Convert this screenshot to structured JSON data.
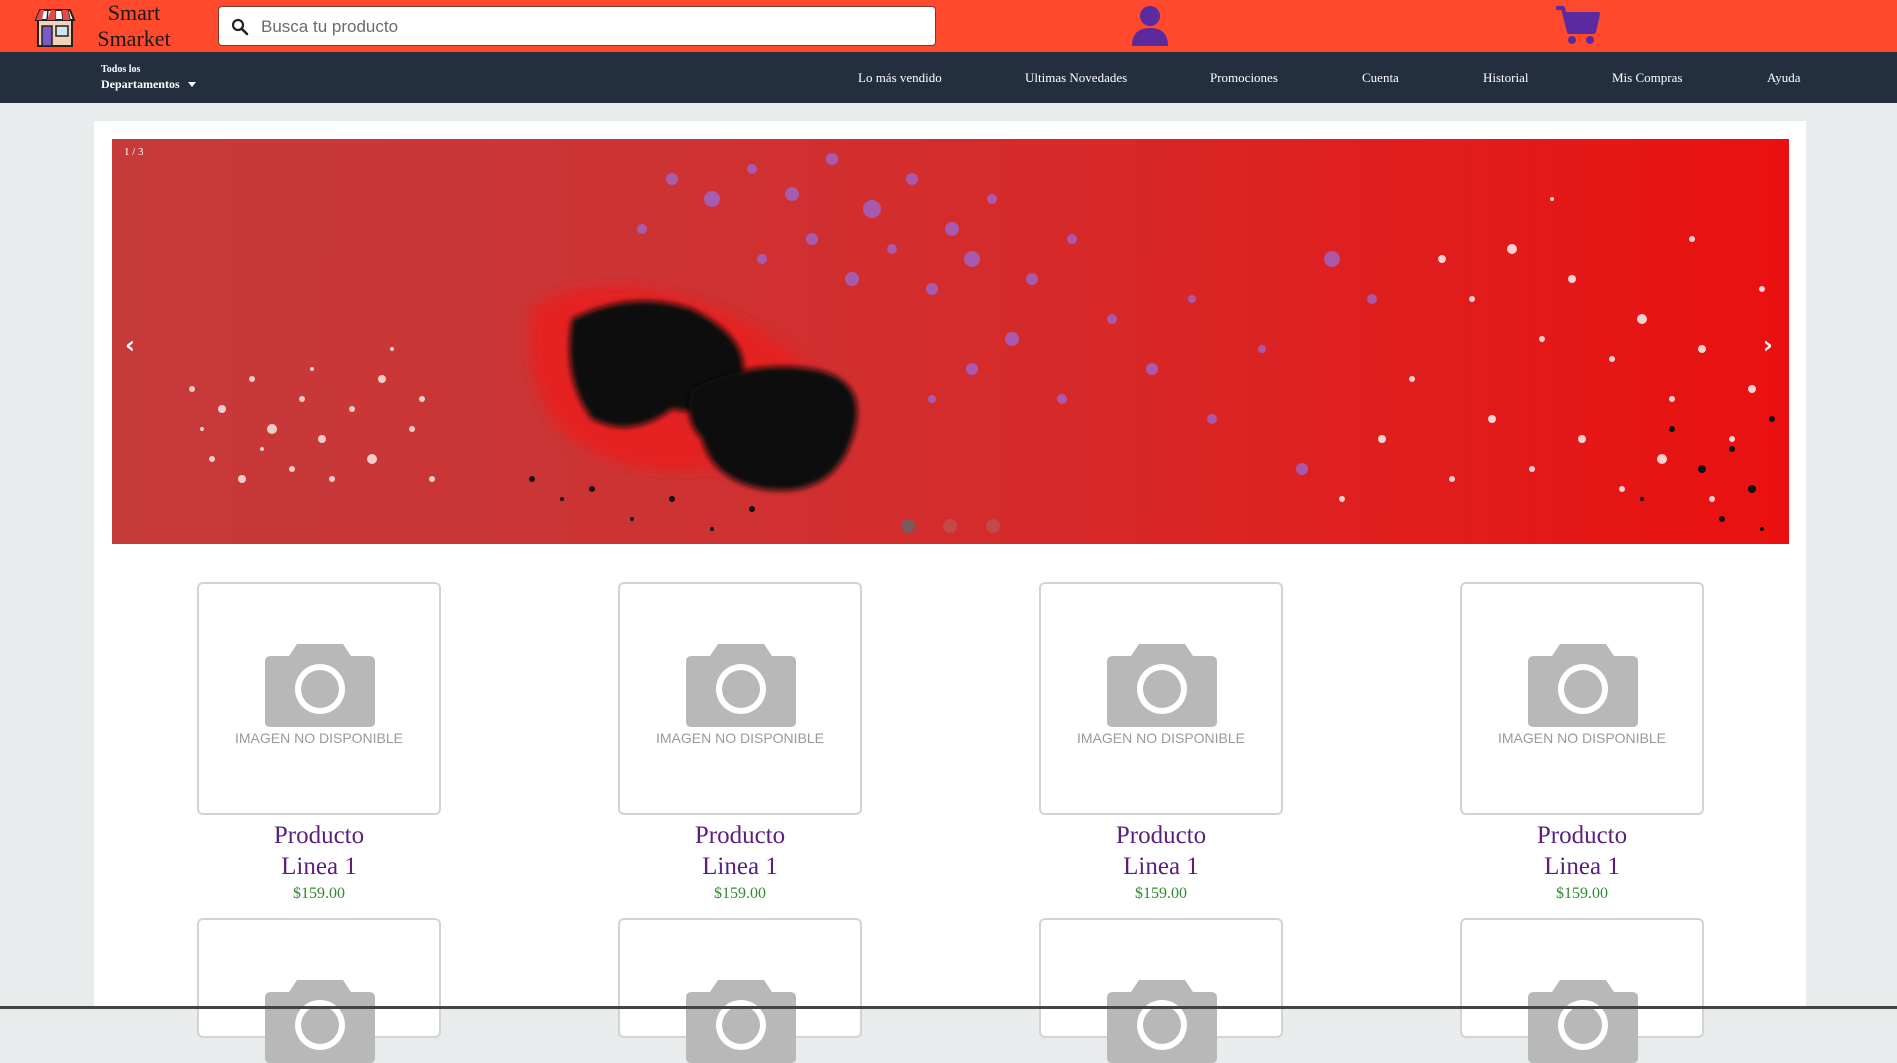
{
  "header": {
    "brand_line1": "Smart",
    "brand_line2": "Smarket",
    "logo_icon": "store-icon",
    "search": {
      "placeholder": "Busca tu producto",
      "value": "",
      "icon": "search-icon"
    },
    "user_icon": "user-icon",
    "cart_icon": "cart-icon",
    "accent_color": "#ff4a2e",
    "icon_color": "#5b2a9e"
  },
  "nav": {
    "departments_small": "Todos los",
    "departments_big": "Departamentos",
    "links": [
      "Lo más vendido",
      "Ultimas Novedades",
      "Promociones",
      "Cuenta",
      "Historial",
      "Mis Compras",
      "Ayuda"
    ],
    "background": "#232f3e"
  },
  "carousel": {
    "counter": "1 / 3",
    "prev": "‹",
    "next": "›",
    "slides_total": 3,
    "active_slide": 1
  },
  "products": [
    {
      "image_text": "IMAGEN NO DISPONIBLE",
      "name_line1": "Producto",
      "name_line2": "Linea 1",
      "price": "$159.00"
    },
    {
      "image_text": "IMAGEN NO DISPONIBLE",
      "name_line1": "Producto",
      "name_line2": "Linea 1",
      "price": "$159.00"
    },
    {
      "image_text": "IMAGEN NO DISPONIBLE",
      "name_line1": "Producto",
      "name_line2": "Linea 1",
      "price": "$159.00"
    },
    {
      "image_text": "IMAGEN NO DISPONIBLE",
      "name_line1": "Producto",
      "name_line2": "Linea 1",
      "price": "$159.00"
    }
  ],
  "colors": {
    "product_name": "#5a1f7e",
    "price": "#2e8b2e"
  }
}
